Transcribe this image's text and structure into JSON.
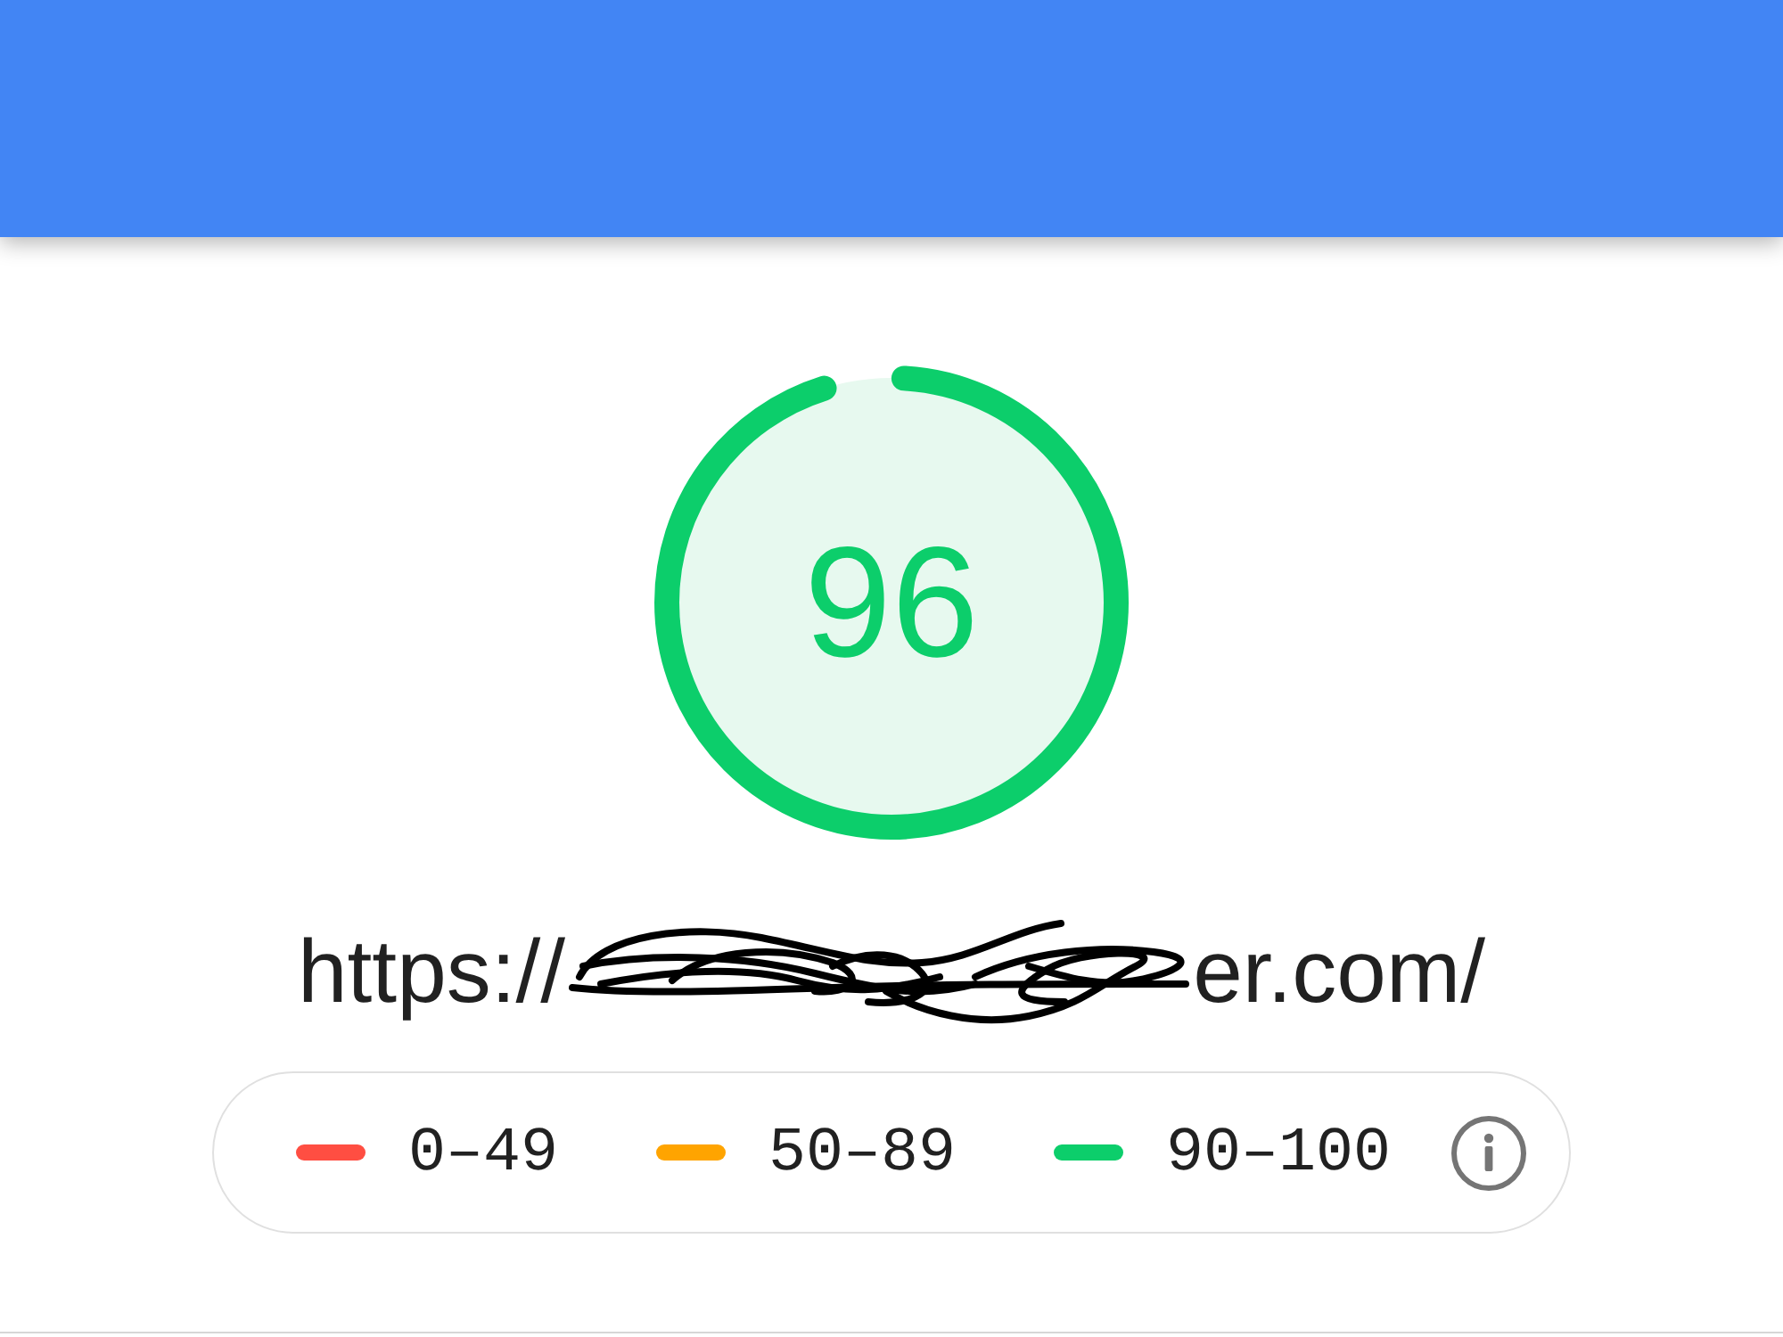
{
  "gauge": {
    "score": "96",
    "level": 0.96
  },
  "url": {
    "visible_start": "https://",
    "redacted": true,
    "visible_end": "er.com/"
  },
  "legend": {
    "items": [
      {
        "label": "0–49",
        "color": "#ff4e42"
      },
      {
        "label": "50–89",
        "color": "#ffa400"
      },
      {
        "label": "90–100",
        "color": "#0cce6b"
      }
    ]
  }
}
